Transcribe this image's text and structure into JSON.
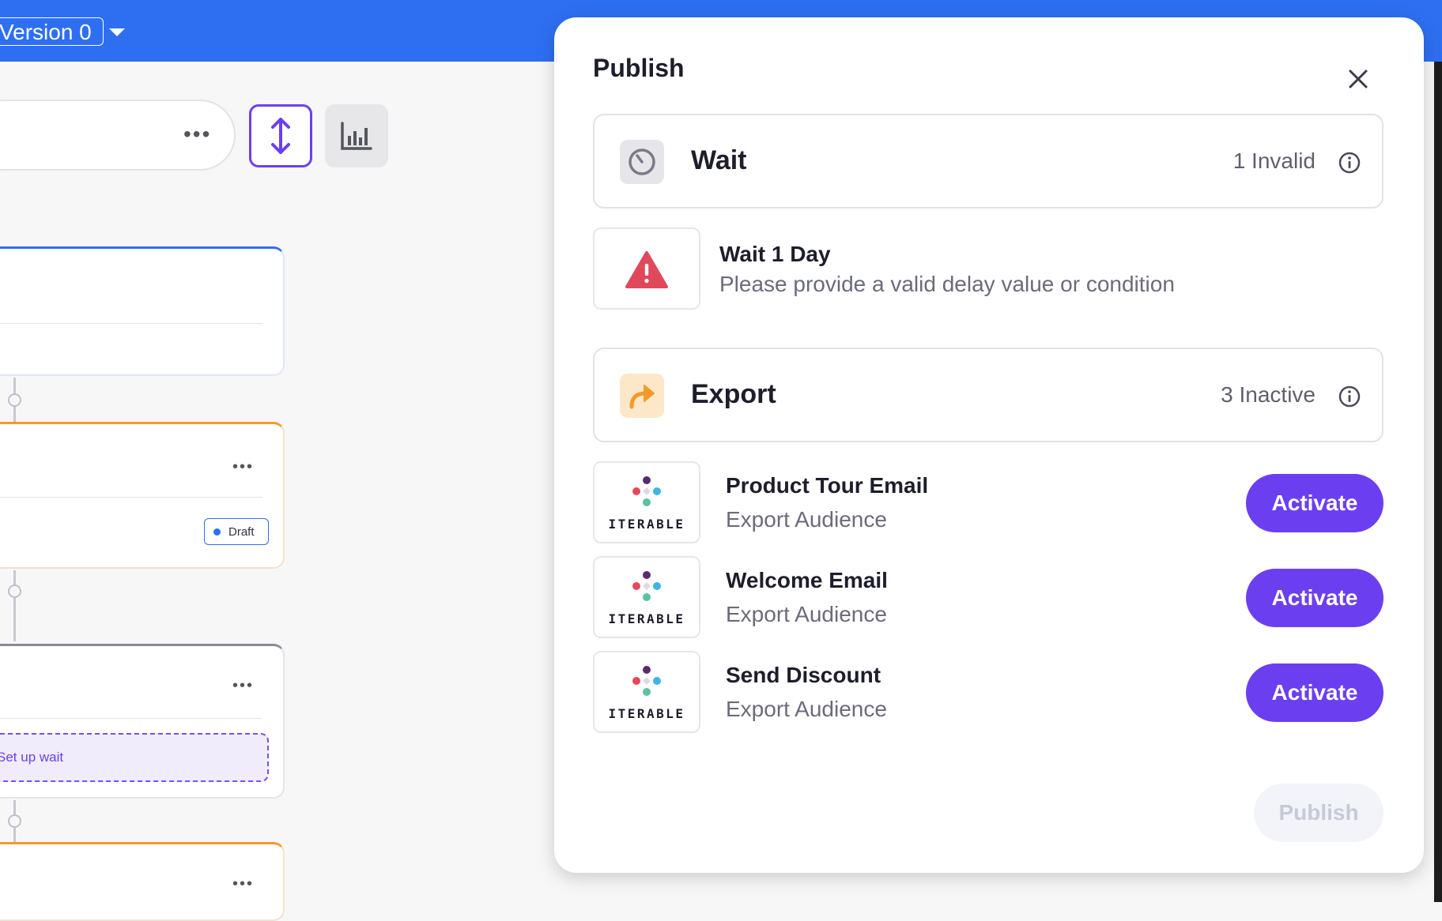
{
  "header": {
    "version_label": "Version 0"
  },
  "canvas": {
    "more_label": "•••",
    "draft_badge": "Draft",
    "setup_wait_label": "Set up wait"
  },
  "modal": {
    "title": "Publish",
    "wait_section": {
      "label": "Wait",
      "count": "1 Invalid"
    },
    "wait_item": {
      "title": "Wait 1 Day",
      "message": "Please provide a valid delay value or condition"
    },
    "export_section": {
      "label": "Export",
      "count": "3 Inactive"
    },
    "export_items": [
      {
        "title": "Product Tour Email",
        "subtitle": "Export Audience",
        "logo_text": "ITERABLE",
        "action": "Activate"
      },
      {
        "title": "Welcome Email",
        "subtitle": "Export Audience",
        "logo_text": "ITERABLE",
        "action": "Activate"
      },
      {
        "title": "Send Discount",
        "subtitle": "Export Audience",
        "logo_text": "ITERABLE",
        "action": "Activate"
      }
    ],
    "publish_label": "Publish"
  },
  "colors": {
    "header_blue": "#2e6ff2",
    "accent_purple": "#6b3ff0",
    "warning_red": "#e0485c",
    "export_orange": "#f39a2b"
  }
}
